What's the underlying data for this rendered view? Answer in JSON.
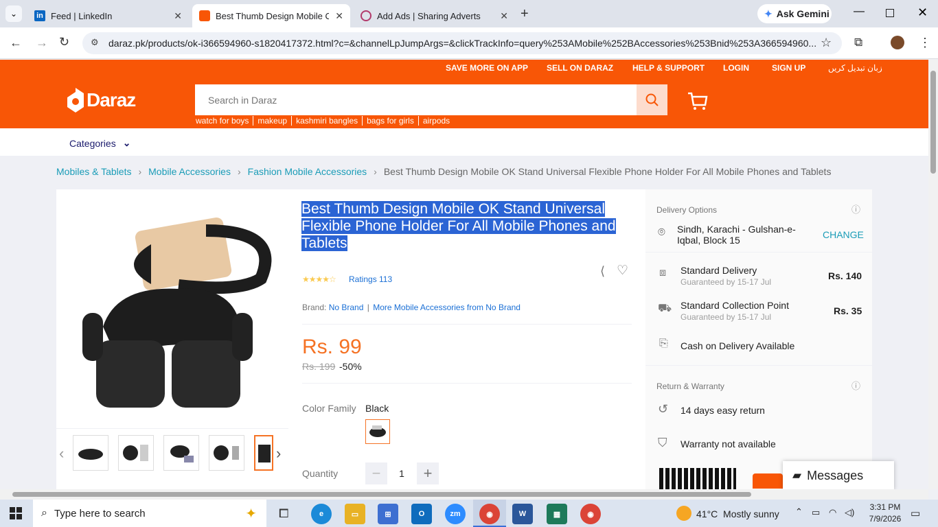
{
  "browser": {
    "tabs": [
      {
        "title": "Feed | LinkedIn"
      },
      {
        "title": "Best Thumb Design Mobile OK"
      },
      {
        "title": "Add Ads | Sharing Adverts"
      }
    ],
    "gemini": "Ask Gemini",
    "url": "daraz.pk/products/ok-i366594960-s1820417372.html?c=&channelLpJumpArgs=&clickTrackInfo=query%253AMobile%252BAccessories%253Bnid%253A366594960..."
  },
  "site": {
    "logo": "Daraz",
    "top_links": [
      "SAVE MORE ON APP",
      "SELL ON DARAZ",
      "HELP & SUPPORT",
      "LOGIN",
      "SIGN UP",
      "زبان تبدیل کریں"
    ],
    "search_placeholder": "Search in Daraz",
    "hot_searches": [
      "watch for boys",
      "makeup",
      "kashmiri bangles",
      "bags for girls",
      "airpods"
    ],
    "categories": "Categories"
  },
  "breadcrumb": [
    "Mobiles & Tablets",
    "Mobile Accessories",
    "Fashion Mobile Accessories",
    "Best Thumb Design Mobile OK Stand Universal Flexible Phone Holder For All Mobile Phones and Tablets"
  ],
  "product": {
    "title": "Best Thumb Design Mobile OK Stand Universal Flexible Phone Holder For All Mobile Phones and Tablets",
    "rating_stars": 4.5,
    "ratings": "Ratings 113",
    "brand_label": "Brand:",
    "brand": "No Brand",
    "more_from": "More Mobile Accessories from No Brand",
    "price": "Rs. 99",
    "old_price": "Rs. 199",
    "discount": "-50%",
    "color_label": "Color Family",
    "color_value": "Black",
    "quantity_label": "Quantity",
    "quantity": "1"
  },
  "delivery": {
    "heading": "Delivery Options",
    "location": "Sindh, Karachi - Gulshan-e-Iqbal, Block 15",
    "change": "CHANGE",
    "options": [
      {
        "name": "Standard Delivery",
        "sub": "Guaranteed by 15-17 Jul",
        "price": "Rs. 140"
      },
      {
        "name": "Standard Collection Point",
        "sub": "Guaranteed by 15-17 Jul",
        "price": "Rs. 35"
      }
    ],
    "cod": "Cash on Delivery Available",
    "return_heading": "Return & Warranty",
    "return": "14 days easy return",
    "warranty": "Warranty not available",
    "messages": "Messages"
  },
  "taskbar": {
    "search": "Type here to search",
    "weather": "41°C  Mostly sunny",
    "time": "3:31 PM",
    "date": "7/9/2026"
  }
}
